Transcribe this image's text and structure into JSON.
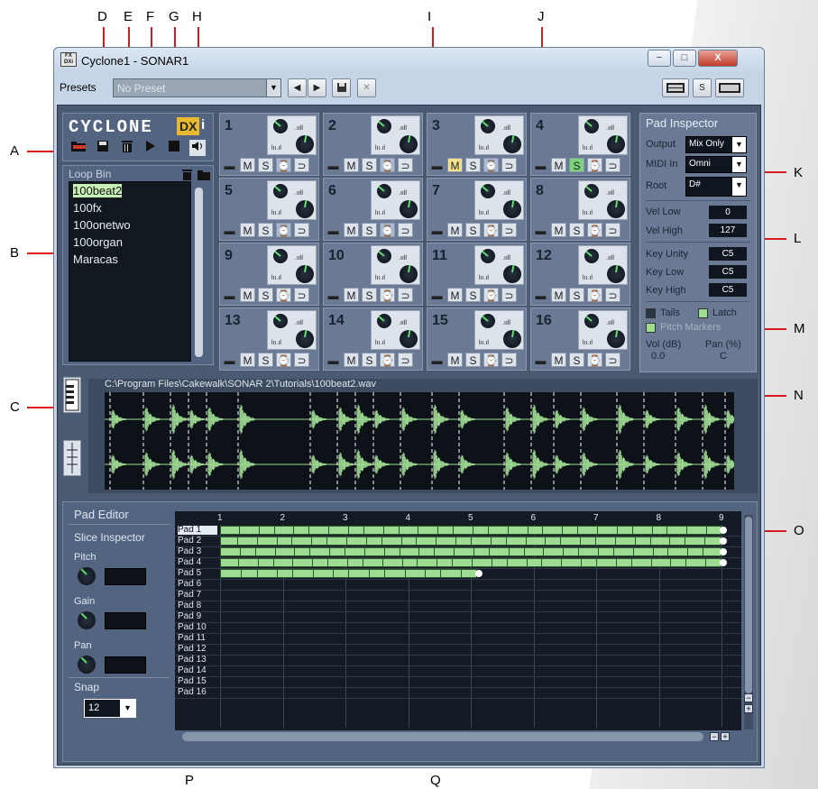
{
  "window": {
    "title": "Cyclone1 - SONAR1",
    "icon_text": "FX\nDXi",
    "buttons": {
      "minimize": "−",
      "maximize": "□",
      "close": "X"
    }
  },
  "presets": {
    "label": "Presets",
    "value": "No Preset",
    "prev": "◀",
    "next": "▶",
    "save": "save",
    "delete": "✕",
    "s_label": "S"
  },
  "logo": {
    "text": "CYCLONE",
    "dx": "DX",
    "i": "i"
  },
  "toolbar_icons": [
    "open-folder-icon",
    "save-icon",
    "trash-icon",
    "play-icon",
    "stop-icon",
    "preview-speaker-icon"
  ],
  "loop_bin": {
    "title": "Loop Bin",
    "items": [
      "100beat2",
      "100fx",
      "100onetwo",
      "100organ",
      "Maracas"
    ],
    "selected": 0
  },
  "pads": {
    "labels": [
      "1",
      "2",
      "3",
      "4",
      "5",
      "6",
      "7",
      "8",
      "9",
      "10",
      "11",
      "12",
      "13",
      "14",
      "15",
      "16"
    ],
    "button_labels": {
      "folder": "▬",
      "mute": "M",
      "solo": "S",
      "clock": "⌚",
      "loop": "⊃"
    },
    "muted": [
      3
    ],
    "soloed": [
      4
    ],
    "clock_on": [
      1,
      2,
      3,
      5,
      6
    ],
    "level_mark": ".ııll",
    "level_mark2": "lıı.ıl"
  },
  "inspector": {
    "title": "Pad Inspector",
    "output_label": "Output",
    "output_value": "Mix Only",
    "midi_label": "MIDI In",
    "midi_value": "Omni",
    "root_label": "Root",
    "root_value": "D#",
    "vel_low_label": "Vel Low",
    "vel_low": "0",
    "vel_high_label": "Vel High",
    "vel_high": "127",
    "key_unity_label": "Key Unity",
    "key_unity": "C5",
    "key_low_label": "Key Low",
    "key_low": "C5",
    "key_high_label": "Key High",
    "key_high": "C5",
    "tails": "Tails",
    "latch": "Latch",
    "pitch_markers": "Pitch Markers",
    "vol_label": "Vol (dB)",
    "pan_label": "Pan (%)",
    "vol_value": "0.0",
    "pan_value": "C"
  },
  "wave": {
    "path": "C:\\Program Files\\Cakewalk\\SONAR 2\\Tutorials\\100beat2.wav"
  },
  "pad_editor": {
    "title": "Pad Editor",
    "slice_inspector": "Slice Inspector",
    "pitch": "Pitch",
    "gain": "Gain",
    "pan": "Pan",
    "snap_label": "Snap",
    "snap_value": "12",
    "beats": [
      "1",
      "2",
      "3",
      "4",
      "5",
      "6",
      "7",
      "8",
      "9"
    ],
    "rows": [
      "Pad 1",
      "Pad 2",
      "Pad 3",
      "Pad 4",
      "Pad 5",
      "Pad 6",
      "Pad 7",
      "Pad 8",
      "Pad 9",
      "Pad 10",
      "Pad 11",
      "Pad 12",
      "Pad 13",
      "Pad 14",
      "Pad 15",
      "Pad 16"
    ],
    "row_lengths_beats": [
      8,
      8,
      8,
      8,
      4.1,
      0,
      0,
      0,
      0,
      0,
      0,
      0,
      0,
      0,
      0,
      0
    ],
    "minus": "−",
    "plus": "+"
  },
  "callouts": [
    "A",
    "B",
    "C",
    "D",
    "E",
    "F",
    "G",
    "H",
    "I",
    "J",
    "K",
    "L",
    "M",
    "N",
    "O",
    "P",
    "Q"
  ],
  "colors": {
    "slice": "#9fdc93",
    "solo": "#7bd37c",
    "mute": "#f4e28a",
    "callout_line": "#d81a1a"
  }
}
